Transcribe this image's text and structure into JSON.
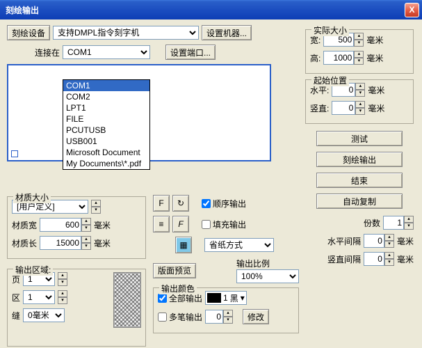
{
  "window": {
    "title": "刻绘输出",
    "close": "X"
  },
  "toolbar": {
    "device_btn": "刻绘设备",
    "device_sel": "支持DMPL指令刻字机",
    "machine_set": "设置机器...",
    "connect_lbl": "连接在",
    "connect_sel": "COM1",
    "port_set": "设置端口...",
    "ports": [
      "COM1",
      "COM2",
      "LPT1",
      "FILE",
      "PCUTUSB",
      "USB001",
      "Microsoft Document ",
      "My Documents\\*.pdf"
    ]
  },
  "actual": {
    "legend": "实际大小",
    "w_lbl": "宽:",
    "w": "500",
    "h_lbl": "高:",
    "h": "1000",
    "unit": "毫米"
  },
  "origin": {
    "legend": "起始位置",
    "x_lbl": "水平:",
    "x": "0",
    "y_lbl": "竖直:",
    "y": "0",
    "unit": "毫米"
  },
  "buttons": {
    "test": "测试",
    "output": "刻绘输出",
    "end": "结束",
    "autocopy": "自动复制"
  },
  "material": {
    "legend": "材质大小",
    "preset": "[用户定义]",
    "w_lbl": "材质宽",
    "w": "600",
    "h_lbl": "材质长",
    "h": "15000",
    "unit": "毫米"
  },
  "region": {
    "legend": "输出区域:",
    "page_lbl": "页",
    "page": "1",
    "area_lbl": "区",
    "area": "1",
    "seam_lbl": "缝",
    "seam": "0毫米"
  },
  "options": {
    "seq": "顺序输出",
    "fill": "填充输出",
    "paper_mode": "省纸方式",
    "preview_btn": "版面预览",
    "ratio_lbl": "输出比例",
    "ratio": "100%",
    "color_legend": "输出颜色",
    "all_out": "全部输出",
    "color_num": "1",
    "color_name": "黑",
    "multi": "多笔输出",
    "multi_val": "0",
    "modify": "修改"
  },
  "copies": {
    "lbl": "份数",
    "val": "1",
    "hgap_lbl": "水平间隔",
    "hgap": "0",
    "vgap_lbl": "竖直间隔",
    "vgap": "0",
    "unit": "毫米"
  },
  "icons": {
    "F": "F",
    "rot": "↻",
    "align": "≡",
    "flip": "F",
    "grid": "▦"
  }
}
